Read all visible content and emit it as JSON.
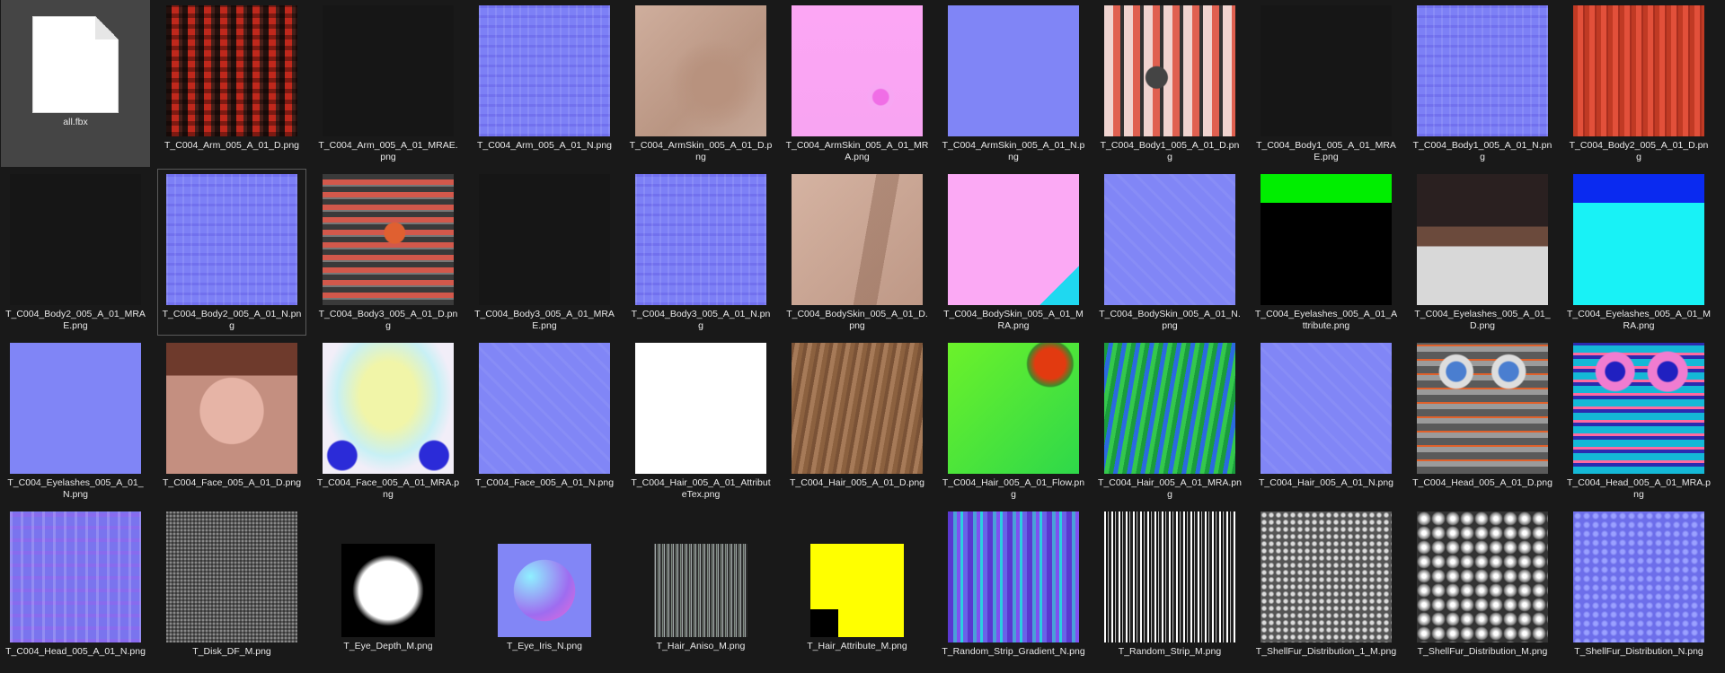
{
  "files": [
    {
      "label": "all.fbx",
      "thumb": "file-icon",
      "icon": "document-file-icon",
      "selected": true
    },
    {
      "label": "T_C004_Arm_005_A_01_D.png",
      "thumb": "arm-d"
    },
    {
      "label": "T_C004_Arm_005_A_01_MRAE.png",
      "thumb": "dark"
    },
    {
      "label": "T_C004_Arm_005_A_01_N.png",
      "thumb": "nrm"
    },
    {
      "label": "T_C004_ArmSkin_005_A_01_D.png",
      "thumb": "skin-d"
    },
    {
      "label": "T_C004_ArmSkin_005_A_01_MRA.png",
      "thumb": "pink"
    },
    {
      "label": "T_C004_ArmSkin_005_A_01_N.png",
      "thumb": "nrm plain"
    },
    {
      "label": "T_C004_Body1_005_A_01_D.png",
      "thumb": "body1-d"
    },
    {
      "label": "T_C004_Body1_005_A_01_MRAE.png",
      "thumb": "dark"
    },
    {
      "label": "T_C004_Body1_005_A_01_N.png",
      "thumb": "nrm"
    },
    {
      "label": "T_C004_Body2_005_A_01_D.png",
      "thumb": "body2-d"
    },
    {
      "label": "T_C004_Body2_005_A_01_MRAE.png",
      "thumb": "dark"
    },
    {
      "label": "T_C004_Body2_005_A_01_N.png",
      "thumb": "nrm",
      "hover": true
    },
    {
      "label": "T_C004_Body3_005_A_01_D.png",
      "thumb": "body3-d"
    },
    {
      "label": "T_C004_Body3_005_A_01_MRAE.png",
      "thumb": "dark"
    },
    {
      "label": "T_C004_Body3_005_A_01_N.png",
      "thumb": "nrm"
    },
    {
      "label": "T_C004_BodySkin_005_A_01_D.png",
      "thumb": "bodyskin-d"
    },
    {
      "label": "T_C004_BodySkin_005_A_01_MRA.png",
      "thumb": "pink2"
    },
    {
      "label": "T_C004_BodySkin_005_A_01_N.png",
      "thumb": "nrm soft"
    },
    {
      "label": "T_C004_Eyelashes_005_A_01_Attribute.png",
      "thumb": "eyelash-attr"
    },
    {
      "label": "T_C004_Eyelashes_005_A_01_D.png",
      "thumb": "eyelash-d"
    },
    {
      "label": "T_C004_Eyelashes_005_A_01_MRA.png",
      "thumb": "eyelash-mra"
    },
    {
      "label": "T_C004_Eyelashes_005_A_01_N.png",
      "thumb": "nrm plain"
    },
    {
      "label": "T_C004_Face_005_A_01_D.png",
      "thumb": "face-d"
    },
    {
      "label": "T_C004_Face_005_A_01_MRA.png",
      "thumb": "face-mra"
    },
    {
      "label": "T_C004_Face_005_A_01_N.png",
      "thumb": "nrm soft"
    },
    {
      "label": "T_C004_Hair_005_A_01_AttributeTex.png",
      "thumb": "white"
    },
    {
      "label": "T_C004_Hair_005_A_01_D.png",
      "thumb": "hair-d"
    },
    {
      "label": "T_C004_Hair_005_A_01_Flow.png",
      "thumb": "flow"
    },
    {
      "label": "T_C004_Hair_005_A_01_MRA.png",
      "thumb": "hair-mra"
    },
    {
      "label": "T_C004_Hair_005_A_01_N.png",
      "thumb": "nrm soft"
    },
    {
      "label": "T_C004_Head_005_A_01_D.png",
      "thumb": "head-d"
    },
    {
      "label": "T_C004_Head_005_A_01_MRA.png",
      "thumb": "head-mra"
    },
    {
      "label": "T_C004_Head_005_A_01_N.png",
      "thumb": "head-n"
    },
    {
      "label": "T_Disk_DF_M.png",
      "thumb": "disk"
    },
    {
      "label": "T_Eye_Depth_M.png",
      "thumb": "eye-depth small"
    },
    {
      "label": "T_Eye_Iris_N.png",
      "thumb": "eye-iris small"
    },
    {
      "label": "T_Hair_Aniso_M.png",
      "thumb": "aniso small"
    },
    {
      "label": "T_Hair_Attribute_M.png",
      "thumb": "hair-attr small"
    },
    {
      "label": "T_Random_Strip_Gradient_N.png",
      "thumb": "strip-grad"
    },
    {
      "label": "T_Random_Strip_M.png",
      "thumb": "strip"
    },
    {
      "label": "T_ShellFur_Distribution_1_M.png",
      "thumb": "fur1"
    },
    {
      "label": "T_ShellFur_Distribution_M.png",
      "thumb": "fur2"
    },
    {
      "label": "T_ShellFur_Distribution_N.png",
      "thumb": "fur-n"
    }
  ]
}
